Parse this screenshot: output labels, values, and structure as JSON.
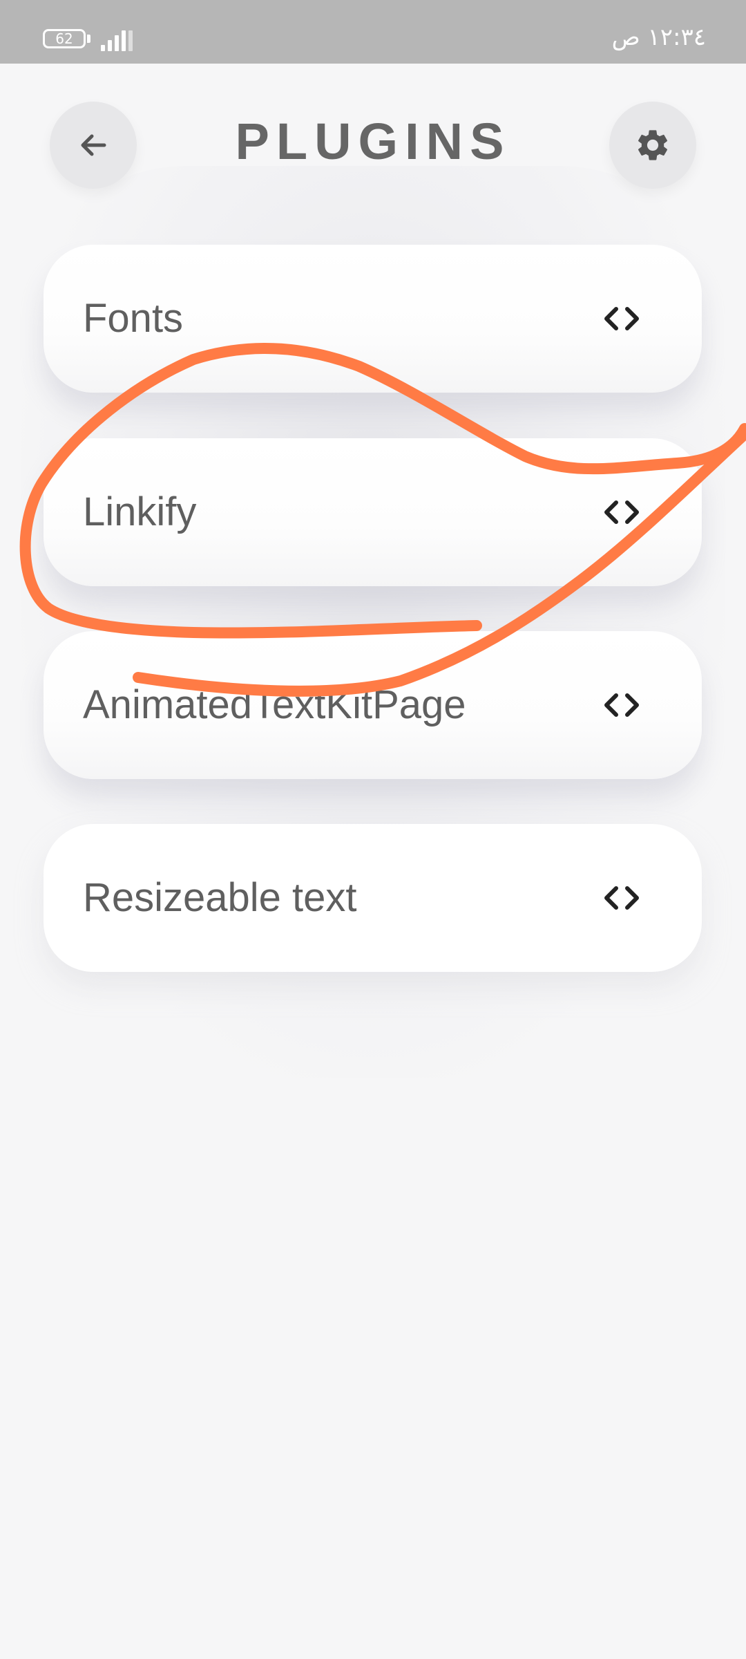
{
  "status_bar": {
    "battery_level": "62",
    "signal_bars": 4,
    "time": "١٢:٣٤ ص"
  },
  "header": {
    "title": "PLUGINS",
    "back_icon": "arrow-left-icon",
    "settings_icon": "gear-icon"
  },
  "plugins": [
    {
      "label": "Fonts",
      "icon": "code-brackets-icon"
    },
    {
      "label": "Linkify",
      "icon": "code-brackets-icon"
    },
    {
      "label": "AnimatedTextKitPage",
      "icon": "code-brackets-icon"
    },
    {
      "label": "Resizeable text",
      "icon": "code-brackets-icon"
    }
  ],
  "colors": {
    "status_bar": "#b6b6b6",
    "background": "#f6f6f7",
    "title_text": "#666666",
    "item_text": "#5f5f5f",
    "round_button": "#e7e7e9",
    "annotation_stroke": "#ff7b45"
  }
}
